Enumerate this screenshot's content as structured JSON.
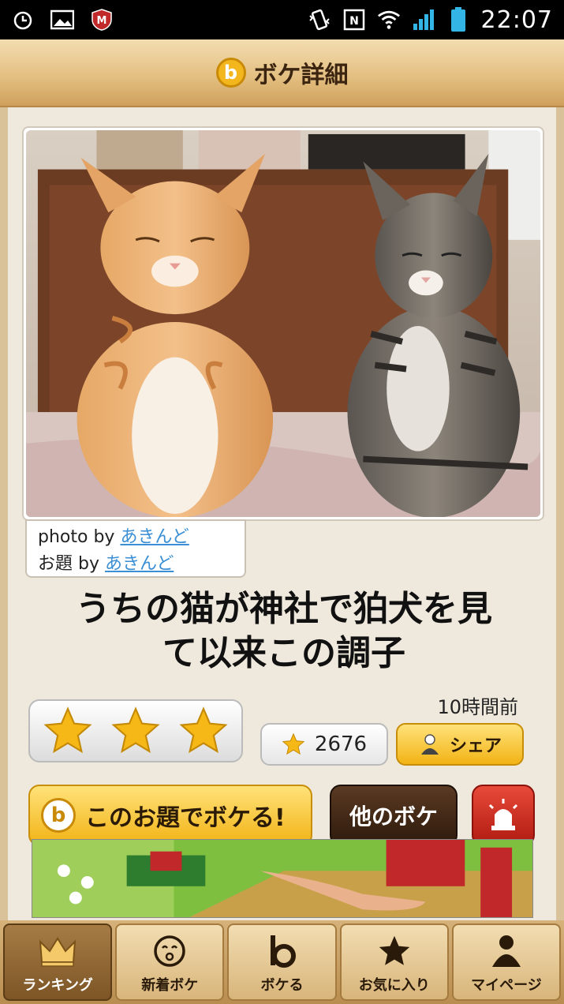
{
  "status_bar": {
    "time": "22:07",
    "left_icons": [
      "alarm-icon",
      "gallery-icon",
      "mcafee-icon"
    ],
    "right_icons": [
      "vibrate-icon",
      "nfc-icon",
      "wifi-icon",
      "signal-icon",
      "battery-icon"
    ]
  },
  "header": {
    "title": "ボケ詳細",
    "logo_letter": "b"
  },
  "photo": {
    "description_icon": "cats-photo"
  },
  "credits": {
    "photo_prefix": "photo by ",
    "photo_user": "あきんど",
    "theme_prefix": "お題 by ",
    "theme_user": "あきんど"
  },
  "caption": {
    "line1": "うちの猫が神社で狛犬を見",
    "line2": "て以来この調子"
  },
  "meta": {
    "timestamp": "10時間前",
    "stars": 3,
    "star_count": "2676",
    "share_label": "シェア"
  },
  "actions": {
    "boke_label": "このお題でボケる!",
    "other_label": "他のボケ"
  },
  "tabs": [
    {
      "label": "ランキング",
      "icon": "crown-icon",
      "active": true
    },
    {
      "label": "新着ボケ",
      "icon": "face-icon",
      "active": false
    },
    {
      "label": "ボケる",
      "icon": "b-logo-icon",
      "active": false
    },
    {
      "label": "お気に入り",
      "icon": "star-icon",
      "active": false
    },
    {
      "label": "マイページ",
      "icon": "person-icon",
      "active": false
    }
  ],
  "colors": {
    "accent_yellow": "#f2b315",
    "link_blue": "#3b8fd4",
    "header_brown": "#3b2410"
  }
}
